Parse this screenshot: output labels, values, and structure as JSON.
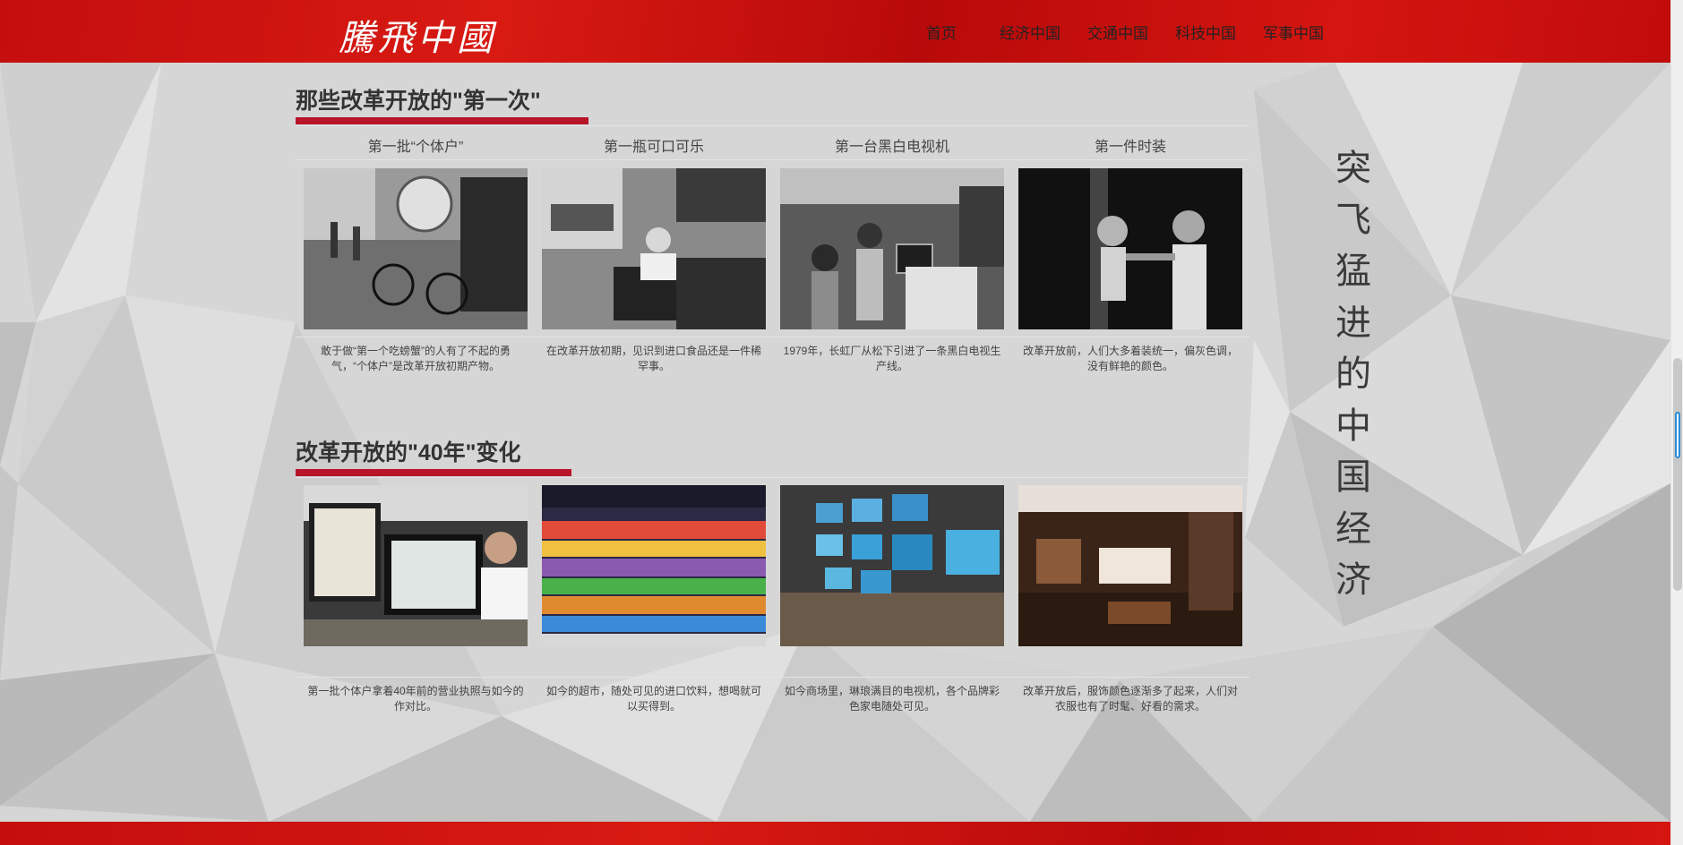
{
  "header": {
    "logo_text": "騰飛中國",
    "nav": [
      "首页",
      "经济中国",
      "交通中国",
      "科技中国",
      "军事中国"
    ]
  },
  "section1": {
    "title": "那些改革开放的\"第一次\"",
    "columns": [
      {
        "label": "第一批“个体户”",
        "photo": "bicycle-street-photo",
        "caption": "敢于做“第一个吃螃蟹”的人有了不起的勇气，“个体户”是改革开放初期产物。"
      },
      {
        "label": "第一瓶可口可乐",
        "photo": "coca-cola-crates-photo",
        "caption": "在改革开放初期，见识到进口食品还是一件稀罕事。"
      },
      {
        "label": "第一台黑白电视机",
        "photo": "television-crowd-photo",
        "caption": "1979年，长虹厂从松下引进了一条黑白电视生产线。"
      },
      {
        "label": "第一件时装",
        "photo": "two-girls-photo",
        "caption": "改革开放前，人们大多着装统一，偏灰色调，没有鲜艳的颜色。"
      }
    ]
  },
  "section2": {
    "title": "改革开放的\"40年\"变化",
    "columns": [
      {
        "photo": "business-license-photo",
        "caption": "第一批个体户拿着40年前的营业执照与如今的作对比。"
      },
      {
        "photo": "supermarket-shelves-photo",
        "caption": "如今的超市，随处可见的进口饮料，想喝就可以买得到。"
      },
      {
        "photo": "tv-store-photo",
        "caption": "如今商场里，琳琅满目的电视机，各个品牌彩色家电随处可见。"
      },
      {
        "photo": "clothing-store-photo",
        "caption": "改革开放后，服饰颜色逐渐多了起来，人们对衣服也有了时髦、好看的需求。"
      }
    ]
  },
  "side_text": [
    "突",
    "飞",
    "猛",
    "进",
    "的",
    "中",
    "国",
    "经",
    "济"
  ],
  "colors": {
    "brand_red": "#c8110f",
    "accent_bar": "#b8142a",
    "background": "#d9d9d9"
  }
}
